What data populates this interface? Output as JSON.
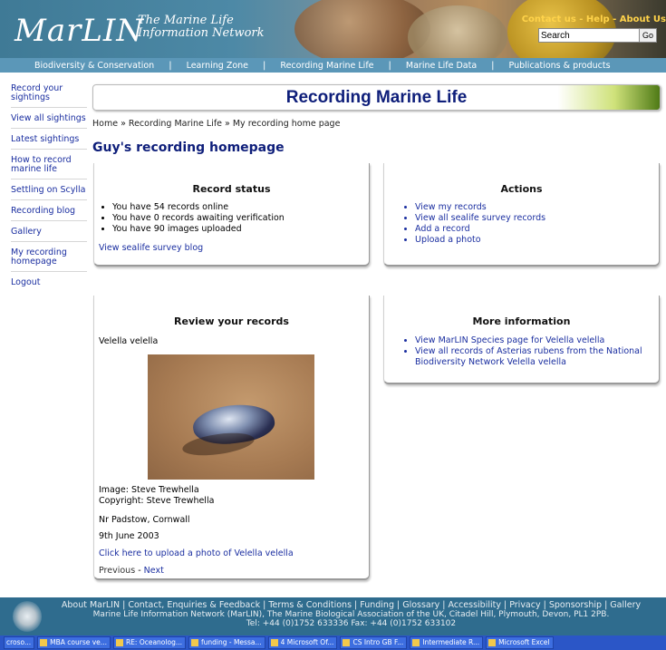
{
  "header": {
    "logo": "MarLIN",
    "logo_sub1": "The Marine Life",
    "logo_sub2": "Information Network",
    "toplinks": "Contact us - Help - About Us",
    "search_value": "Search",
    "search_go": "Go"
  },
  "nav": [
    "Biodiversity & Conservation",
    "Learning Zone",
    "Recording Marine Life",
    "Marine Life Data",
    "Publications & products"
  ],
  "sidebar": [
    "Record your sightings",
    "View all sightings",
    "Latest sightings",
    "How to record marine life",
    "Settling on Scylla",
    "Recording blog",
    "Gallery",
    "My recording homepage",
    "Logout"
  ],
  "title": "Recording Marine Life",
  "breadcrumb": "Home » Recording Marine Life » My recording home page",
  "heading": "Guy's recording homepage",
  "record_status": {
    "title": "Record status",
    "items": [
      "You have 54 records online",
      "You have 0 records awaiting verification",
      "You have 90 images uploaded"
    ],
    "link": "View sealife survey blog"
  },
  "actions": {
    "title": "Actions",
    "items": [
      "View my records",
      "View all sealife survey records",
      "Add a record",
      "Upload a photo"
    ]
  },
  "review": {
    "title": "Review your records",
    "species": "Velella velella",
    "image_credit": "Image: Steve Trewhella",
    "copyright": "Copyright: Steve Trewhella",
    "location": "Nr Padstow, Cornwall",
    "date": "9th June 2003",
    "upload_link": "Click here to upload a photo of Velella velella",
    "previous": "Previous",
    "sep": "-",
    "next": "Next"
  },
  "more_info": {
    "title": "More information",
    "items": [
      "View MarLIN Species page for Velella velella",
      "View all records of Asterias rubens from the National Biodiversity Network Velella velella"
    ]
  },
  "footer": {
    "links": "About MarLIN | Contact, Enquiries & Feedback | Terms & Conditions | Funding | Glossary | Accessibility | Privacy | Sponsorship | Gallery",
    "address": "Marine Life Information Network (MarLIN), The Marine Biological Association of the UK, Citadel Hill, Plymouth, Devon, PL1 2PB.",
    "phone": "Tel: +44 (0)1752 633336 Fax: +44 (0)1752 633102"
  },
  "taskbar": [
    "croso...",
    "MBA course ve...",
    "RE: Oceanolog...",
    "funding - Messa...",
    "4 Microsoft Of...",
    "CS Intro GB F...",
    "Intermediate R...",
    "Microsoft Excel"
  ],
  "colors": {
    "link": "#1a2ea0",
    "heading": "#0e1e7a",
    "nav_bar": "#5b97b8",
    "footer": "#2f6c8e",
    "taskbar": "#2b56c7"
  }
}
